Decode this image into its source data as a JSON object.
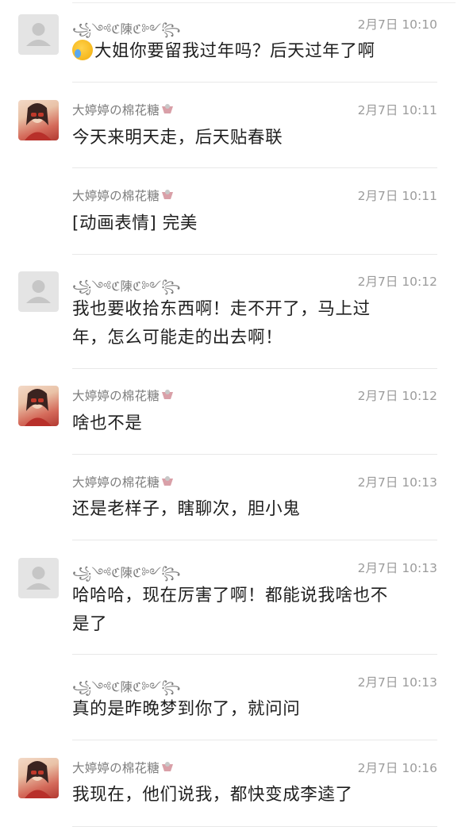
{
  "messages": [
    {
      "sender": "꧁༺ℭ陳ℭ༻꧂",
      "avatar": "default",
      "time": "2月7日 10:10",
      "lines": [
        "大姐你要留我过年吗？后天过年了啊"
      ],
      "emoji": "crying-laughing-emoji"
    },
    {
      "sender": "大婷婷の棉花糖",
      "avatar": "photo",
      "time": "2月7日 10:11",
      "lines": [
        "今天来明天走，后天贴春联"
      ]
    },
    {
      "sender": "大婷婷の棉花糖",
      "avatar": "none",
      "time": "2月7日 10:11",
      "lines": [
        "[动画表情] 完美"
      ]
    },
    {
      "sender": "꧁༺ℭ陳ℭ༻꧂",
      "avatar": "default",
      "time": "2月7日 10:12",
      "lines": [
        "我也要收拾东西啊！走不开了，马上过",
        "年，怎么可能走的出去啊！"
      ]
    },
    {
      "sender": "大婷婷の棉花糖",
      "avatar": "photo",
      "time": "2月7日 10:12",
      "lines": [
        "啥也不是"
      ]
    },
    {
      "sender": "大婷婷の棉花糖",
      "avatar": "none",
      "time": "2月7日 10:13",
      "lines": [
        "还是老样子，瞎聊次，胆小鬼"
      ]
    },
    {
      "sender": "꧁༺ℭ陳ℭ༻꧂",
      "avatar": "default",
      "time": "2月7日 10:13",
      "lines": [
        "哈哈哈，现在厉害了啊！都能说我啥也不",
        "是了"
      ]
    },
    {
      "sender": "꧁༺ℭ陳ℭ༻꧂",
      "avatar": "none",
      "time": "2月7日 10:13",
      "lines": [
        "真的是昨晚梦到你了，就问问"
      ]
    },
    {
      "sender": "大婷婷の棉花糖",
      "avatar": "photo",
      "time": "2月7日 10:16",
      "lines": [
        "我现在，他们说我，都快变成李逵了"
      ]
    }
  ]
}
